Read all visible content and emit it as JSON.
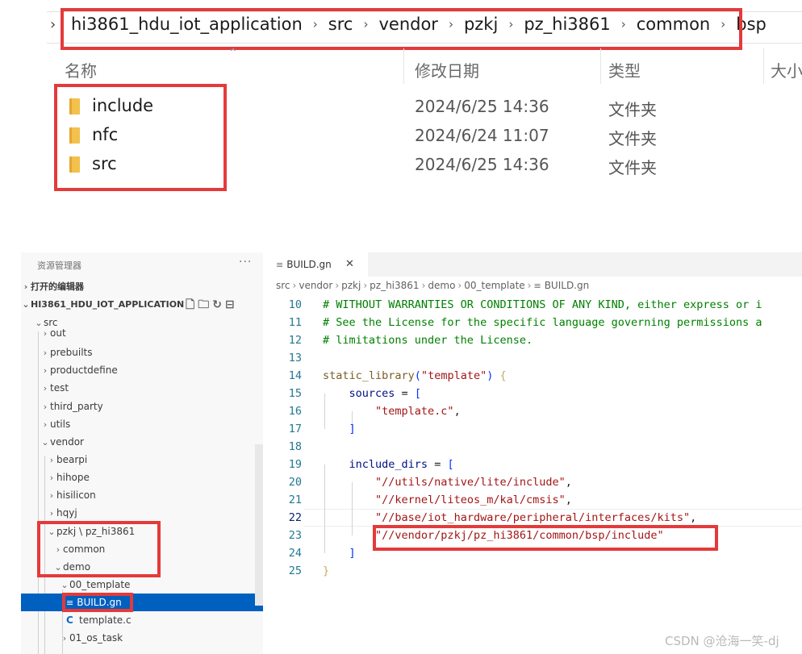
{
  "explorer": {
    "path": [
      "hi3861_hdu_iot_application",
      "src",
      "vendor",
      "pzkj",
      "pz_hi3861",
      "common",
      "bsp"
    ],
    "columns": {
      "name": "名称",
      "modified": "修改日期",
      "type": "类型",
      "size": "大小"
    },
    "files": [
      {
        "name": "include",
        "modified": "2024/6/25 14:36",
        "type": "文件夹"
      },
      {
        "name": "nfc",
        "modified": "2024/6/24 11:07",
        "type": "文件夹"
      },
      {
        "name": "src",
        "modified": "2024/6/25 14:36",
        "type": "文件夹"
      }
    ]
  },
  "vscode": {
    "sidebar": {
      "title": "资源管理器",
      "more": "···",
      "open_editors": "打开的编辑器",
      "project": "HI3861_HDU_IOT_APPLICATION",
      "tree": [
        "src",
        "out",
        "prebuilts",
        "productdefine",
        "test",
        "third_party",
        "utils",
        "vendor",
        "bearpi",
        "hihope",
        "hisilicon",
        "hqyj",
        "pzkj \\ pz_hi3861",
        "common",
        "demo",
        "00_template",
        "BUILD.gn",
        "template.c",
        "01_os_task"
      ]
    },
    "tab": {
      "label": "BUILD.gn",
      "close": "✕"
    },
    "breadcrumbs": [
      "src",
      "vendor",
      "pzkj",
      "pz_hi3861",
      "demo",
      "00_template",
      "BUILD.gn"
    ],
    "code": {
      "line_numbers": [
        "10",
        "11",
        "12",
        "13",
        "14",
        "15",
        "16",
        "17",
        "18",
        "19",
        "20",
        "21",
        "22",
        "23",
        "24",
        "25"
      ],
      "comments": [
        "# WITHOUT WARRANTIES OR CONDITIONS OF ANY KIND, either express or i",
        "# See the License for the specific language governing permissions a",
        "# limitations under the License."
      ],
      "static_library": "static_library",
      "template_str": "\"template\"",
      "sources": "sources",
      "template_c": "\"template.c\"",
      "include_dirs": "include_dirs",
      "dirs": [
        "\"//utils/native/lite/include\"",
        "\"//kernel/liteos_m/kal/cmsis\"",
        "\"//base/iot_hardware/peripheral/interfaces/kits\"",
        "\"//vendor/pzkj/pz_hi3861/common/bsp/include\""
      ]
    }
  },
  "watermark": "CSDN @沧海一笑-dj",
  "colors": {
    "highlight_box": "#e43a3a",
    "selection": "#0060c0"
  }
}
